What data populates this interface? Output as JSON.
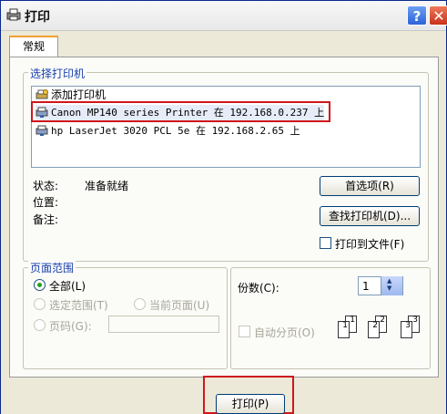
{
  "window": {
    "title": "打印",
    "help_label": "?",
    "close_label": "✕"
  },
  "tabs": [
    {
      "label": "常规"
    }
  ],
  "printer_group": {
    "label": "选择打印机",
    "items": [
      {
        "label": "添加打印机",
        "icon": "add-printer-icon"
      },
      {
        "label": "Canon MP140 series Printer 在 192.168.0.237 上",
        "icon": "network-printer-icon",
        "selected": true
      },
      {
        "label": "hp LaserJet 3020 PCL 5e 在 192.168.2.65 上",
        "icon": "network-printer-icon"
      }
    ],
    "status_label": "状态:",
    "status_value": "准备就绪",
    "location_label": "位置:",
    "comment_label": "备注:",
    "preferences_label": "首选项(R)",
    "find_printer_label": "查找打印机(D)...",
    "print_to_file_label": "打印到文件(F)"
  },
  "page_range": {
    "label": "页面范围",
    "all_label": "全部(L)",
    "selection_label": "选定范围(T)",
    "current_page_label": "当前页面(U)",
    "pages_label": "页码(G):",
    "pages_value": ""
  },
  "copies": {
    "label": "份数(C):",
    "value": "1",
    "collate_label": "自动分页(O)",
    "collate_pages": [
      "1",
      "1",
      "2",
      "2",
      "3",
      "3"
    ]
  },
  "footer": {
    "print_label": "打印(P)"
  },
  "colors": {
    "accent_red": "#d0161b",
    "title_blue": "#1a3fae"
  }
}
